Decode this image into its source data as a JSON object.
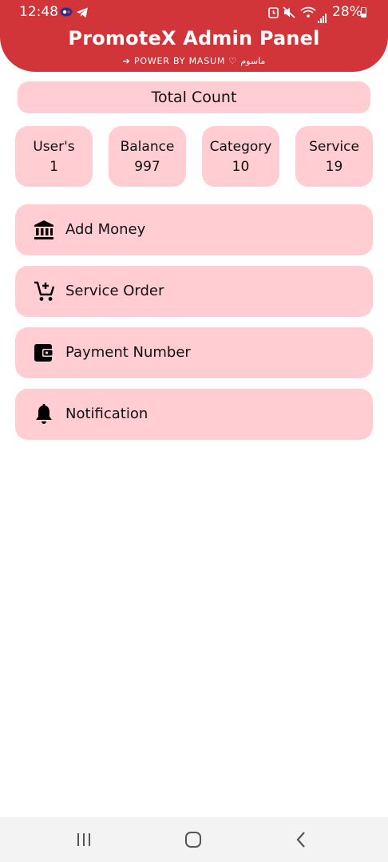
{
  "status_bar": {
    "time": "12:48",
    "battery": "28%"
  },
  "header": {
    "title": "PromoteX Admin Panel",
    "subtitle": "➔ POWER  BY  MASUM ♡ ماسوم"
  },
  "total_count_label": "Total Count",
  "stats": [
    {
      "label": "User's",
      "value": "1"
    },
    {
      "label": "Balance",
      "value": "997"
    },
    {
      "label": "Category",
      "value": "10"
    },
    {
      "label": "Service",
      "value": "19"
    }
  ],
  "menu": [
    {
      "label": "Add Money",
      "icon": "bank-icon"
    },
    {
      "label": "Service Order",
      "icon": "add-cart-icon"
    },
    {
      "label": "Payment Number",
      "icon": "wallet-icon"
    },
    {
      "label": "Notification",
      "icon": "bell-icon"
    }
  ],
  "colors": {
    "header": "#d13539",
    "card": "#ffcdd2",
    "text": "#111111",
    "background": "#ffffff"
  }
}
